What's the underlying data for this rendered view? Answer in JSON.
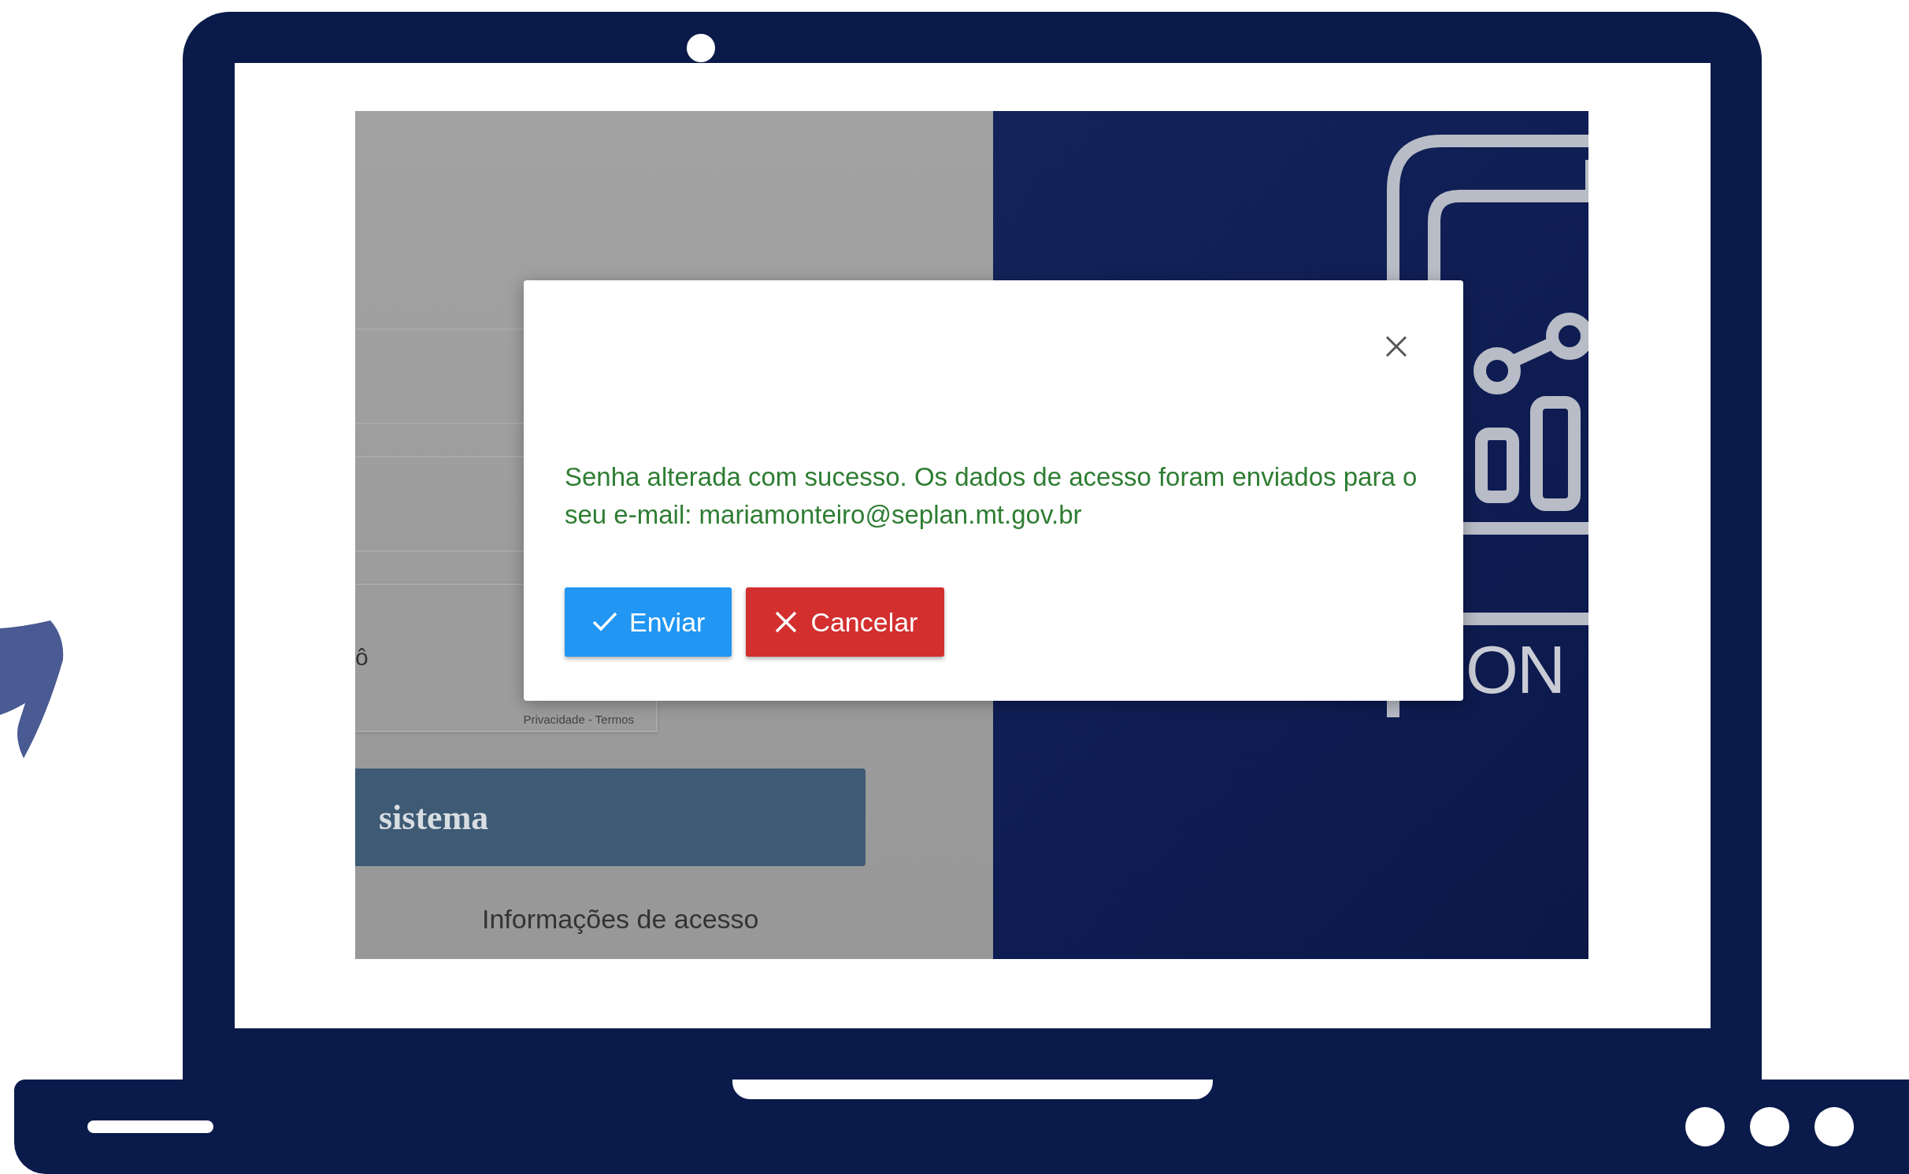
{
  "login_page": {
    "recaptcha_fragment": "ô",
    "recaptcha_links": "Privacidade - Termos",
    "login_button": "sistema",
    "access_info_link": "Informações de acesso",
    "logo_text_fragment": "ON"
  },
  "dialog": {
    "message": "Senha alterada com sucesso. Os dados de acesso foram enviados para o seu e-mail: mariamonteiro@seplan.mt.gov.br",
    "buttons": [
      {
        "label": "Enviar",
        "kind": "confirm"
      },
      {
        "label": "Cancelar",
        "kind": "cancel"
      }
    ]
  }
}
